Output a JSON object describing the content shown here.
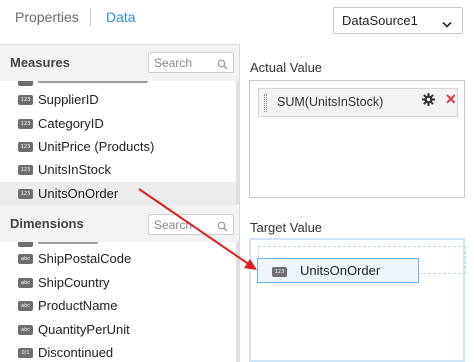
{
  "tabs": {
    "properties": "Properties",
    "data": "Data"
  },
  "datasource": {
    "selected": "DataSource1"
  },
  "measures": {
    "title": "Measures",
    "search_placeholder": "Search",
    "items": [
      {
        "label": "SupplierID",
        "badge": "123"
      },
      {
        "label": "CategoryID",
        "badge": "123"
      },
      {
        "label": "UnitPrice (Products)",
        "badge": "123"
      },
      {
        "label": "UnitsInStock",
        "badge": "123"
      },
      {
        "label": "UnitsOnOrder",
        "badge": "123"
      }
    ]
  },
  "dimensions": {
    "title": "Dimensions",
    "search_placeholder": "Search",
    "items": [
      {
        "label": "ShipPostalCode",
        "badge": "abc"
      },
      {
        "label": "ShipCountry",
        "badge": "abc"
      },
      {
        "label": "ProductName",
        "badge": "abc"
      },
      {
        "label": "QuantityPerUnit",
        "badge": "abc"
      },
      {
        "label": "Discontinued",
        "badge": "0/1"
      }
    ]
  },
  "actual_value": {
    "title": "Actual Value",
    "field": "SUM(UnitsInStock)"
  },
  "target_value": {
    "title": "Target Value",
    "dragging_field": "UnitsOnOrder",
    "dragging_badge": "123"
  },
  "colors": {
    "accent": "#2f8fd6",
    "arrow": "#e02020",
    "remove": "#d93434"
  },
  "icons": {
    "dropdown": "chevron-down-icon",
    "search": "search-icon",
    "settings": "gear-icon",
    "remove": "close-icon"
  }
}
